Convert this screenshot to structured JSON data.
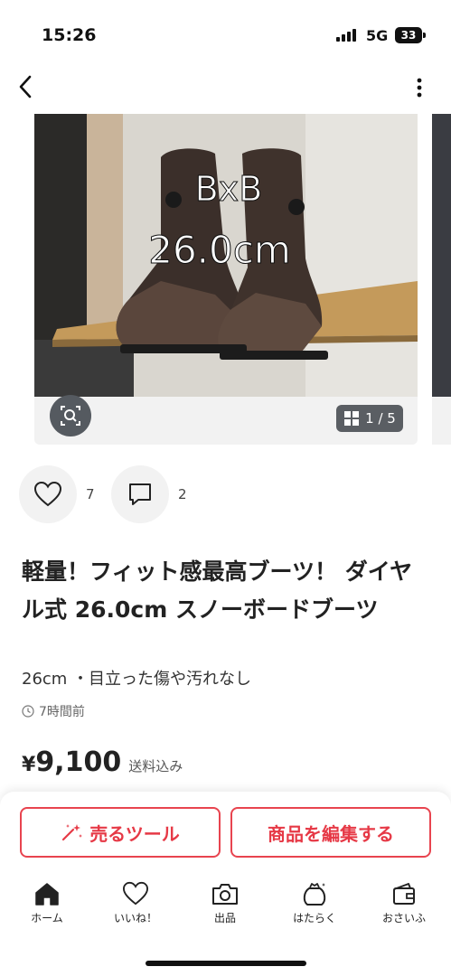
{
  "status_bar": {
    "time": "15:26",
    "network": "5G",
    "battery": "33"
  },
  "gallery": {
    "photo_overlay_line1": "BxB",
    "photo_overlay_line2": "26.0cm",
    "counter": "1 / 5"
  },
  "actions": {
    "likes_count": "7",
    "comments_count": "2"
  },
  "item": {
    "title": "軽量！フィット感最高ブーツ！ ダイヤル式 26.0cm スノーボードブーツ",
    "subtitle": "26cm ・目立った傷や汚れなし",
    "posted": "7時間前",
    "price_symbol": "¥",
    "price": "9,100",
    "shipping": "送料込み"
  },
  "bottom": {
    "sell_tool_label": "売るツール",
    "edit_label": "商品を編集する"
  },
  "nav": {
    "items": [
      {
        "label": "ホーム",
        "icon": "home-icon"
      },
      {
        "label": "いいね！",
        "icon": "heart-icon"
      },
      {
        "label": "出品",
        "icon": "camera-icon"
      },
      {
        "label": "はたらく",
        "icon": "bag-icon"
      },
      {
        "label": "おさいふ",
        "icon": "wallet-icon"
      }
    ]
  },
  "colors": {
    "accent": "#e63946",
    "card_bg": "#f2f2f2"
  }
}
